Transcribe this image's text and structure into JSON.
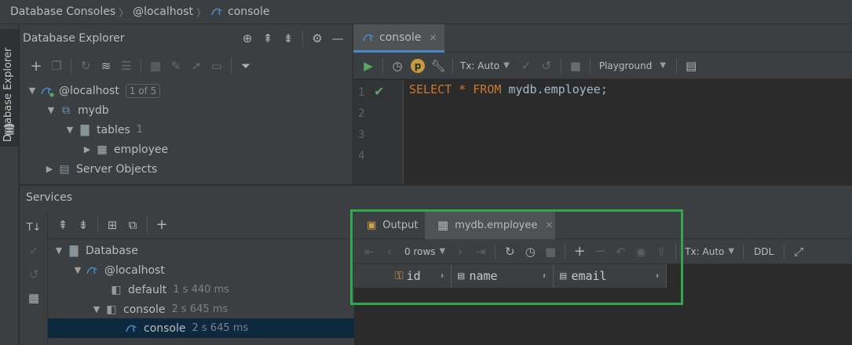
{
  "breadcrumb": {
    "root": "Database Consoles",
    "host": "@localhost",
    "console": "console"
  },
  "sidebar": {
    "tab_label": "Database Explorer"
  },
  "explorer": {
    "title": "Database Explorer",
    "tree": {
      "host": {
        "label": "@localhost",
        "badge": "1 of 5"
      },
      "schema": "mydb",
      "tables": {
        "label": "tables",
        "count": "1"
      },
      "table": "employee",
      "server_objects": "Server Objects"
    }
  },
  "editor": {
    "tab_label": "console",
    "tx_mode": "Tx: Auto",
    "session": "Playground",
    "line_numbers": [
      "1",
      "2",
      "3",
      "4"
    ],
    "code": {
      "kw1": "SELECT",
      "star": "*",
      "kw2": "FROM",
      "rest": "mydb.employee;"
    }
  },
  "services": {
    "title": "Services",
    "tree": {
      "database": "Database",
      "host": "@localhost",
      "default": {
        "label": "default",
        "time": "1 s 440 ms"
      },
      "console_group": {
        "label": "console",
        "time": "2 s 645 ms"
      },
      "console_item": {
        "label": "console",
        "time": "2 s 645 ms"
      }
    },
    "result": {
      "tabs": {
        "output": "Output",
        "table": "mydb.employee"
      },
      "rows": "0 rows",
      "tx_mode": "Tx: Auto",
      "ddl": "DDL",
      "columns": [
        "id",
        "name",
        "email"
      ]
    }
  },
  "colors": {
    "accent": "#4a88c7",
    "highlight": "#2fa84f",
    "keyword": "#cc7832",
    "run": "#59a869"
  }
}
